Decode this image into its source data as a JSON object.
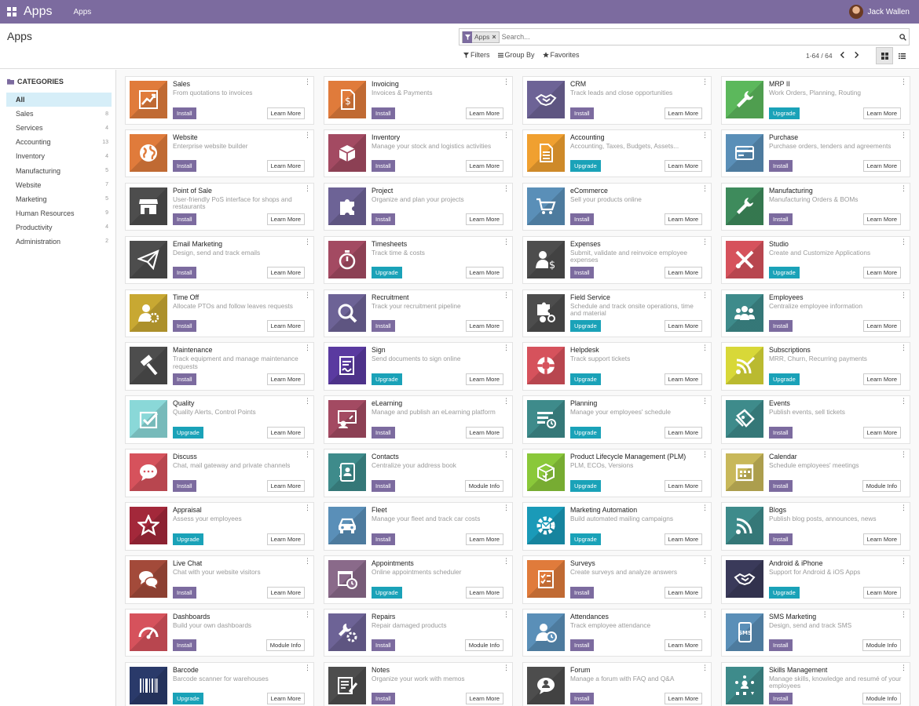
{
  "topbar": {
    "brand": "Apps",
    "menu": "Apps",
    "user": "Jack Wallen"
  },
  "control": {
    "title": "Apps",
    "facet": "Apps",
    "search_placeholder": "Search...",
    "filters": "Filters",
    "group_by": "Group By",
    "favorites": "Favorites",
    "pager": "1-64 / 64"
  },
  "sidebar": {
    "title": "CATEGORIES",
    "items": [
      {
        "label": "All",
        "count": ""
      },
      {
        "label": "Sales",
        "count": "8"
      },
      {
        "label": "Services",
        "count": "4"
      },
      {
        "label": "Accounting",
        "count": "13"
      },
      {
        "label": "Inventory",
        "count": "4"
      },
      {
        "label": "Manufacturing",
        "count": "5"
      },
      {
        "label": "Website",
        "count": "7"
      },
      {
        "label": "Marketing",
        "count": "5"
      },
      {
        "label": "Human Resources",
        "count": "9"
      },
      {
        "label": "Productivity",
        "count": "4"
      },
      {
        "label": "Administration",
        "count": "2"
      }
    ]
  },
  "apps": [
    {
      "name": "Sales",
      "desc": "From quotations to invoices",
      "action": "Install",
      "info": "Learn More",
      "color": "#e07b3b",
      "icon": "chart-icon"
    },
    {
      "name": "Invoicing",
      "desc": "Invoices & Payments",
      "action": "Install",
      "info": "Learn More",
      "color": "#e07b3b",
      "icon": "invoice-icon"
    },
    {
      "name": "CRM",
      "desc": "Track leads and close opportunities",
      "action": "Install",
      "info": "Learn More",
      "color": "#6d6396",
      "icon": "handshake-icon"
    },
    {
      "name": "MRP II",
      "desc": "Work Orders, Planning, Routing",
      "action": "Upgrade",
      "info": "Learn More",
      "color": "#5cb85c",
      "icon": "wrench-icon"
    },
    {
      "name": "Website",
      "desc": "Enterprise website builder",
      "action": "Install",
      "info": "Learn More",
      "color": "#e07b3b",
      "icon": "globe-icon"
    },
    {
      "name": "Inventory",
      "desc": "Manage your stock and logistics activities",
      "action": "Install",
      "info": "Learn More",
      "color": "#a34a62",
      "icon": "box-icon"
    },
    {
      "name": "Accounting",
      "desc": "Accounting, Taxes, Budgets, Assets...",
      "action": "Upgrade",
      "info": "Learn More",
      "color": "#f0a030",
      "icon": "document-icon"
    },
    {
      "name": "Purchase",
      "desc": "Purchase orders, tenders and agreements",
      "action": "Install",
      "info": "Learn More",
      "color": "#5a8fb8",
      "icon": "card-icon"
    },
    {
      "name": "Point of Sale",
      "desc": "User-friendly PoS interface for shops and restaurants",
      "action": "Install",
      "info": "Learn More",
      "color": "#4d4d4d",
      "icon": "store-icon"
    },
    {
      "name": "Project",
      "desc": "Organize and plan your projects",
      "action": "Install",
      "info": "Learn More",
      "color": "#6d6396",
      "icon": "puzzle-icon"
    },
    {
      "name": "eCommerce",
      "desc": "Sell your products online",
      "action": "Install",
      "info": "Learn More",
      "color": "#5a8fb8",
      "icon": "cart-icon"
    },
    {
      "name": "Manufacturing",
      "desc": "Manufacturing Orders & BOMs",
      "action": "Install",
      "info": "Learn More",
      "color": "#3e8b5c",
      "icon": "wrench-icon"
    },
    {
      "name": "Email Marketing",
      "desc": "Design, send and track emails",
      "action": "Install",
      "info": "Learn More",
      "color": "#4d4d4d",
      "icon": "paper-plane-icon"
    },
    {
      "name": "Timesheets",
      "desc": "Track time & costs",
      "action": "Upgrade",
      "info": "Learn More",
      "color": "#a34a62",
      "icon": "stopwatch-icon"
    },
    {
      "name": "Expenses",
      "desc": "Submit, validate and reinvoice employee expenses",
      "action": "Install",
      "info": "Learn More",
      "color": "#4d4d4d",
      "icon": "user-dollar-icon"
    },
    {
      "name": "Studio",
      "desc": "Create and Customize Applications",
      "action": "Upgrade",
      "info": "Learn More",
      "color": "#d6525c",
      "icon": "tools-icon"
    },
    {
      "name": "Time Off",
      "desc": "Allocate PTOs and follow leaves requests",
      "action": "Install",
      "info": "Learn More",
      "color": "#c8a832",
      "icon": "user-gear-icon"
    },
    {
      "name": "Recruitment",
      "desc": "Track your recruitment pipeline",
      "action": "Install",
      "info": "Learn More",
      "color": "#6d6396",
      "icon": "magnifier-icon"
    },
    {
      "name": "Field Service",
      "desc": "Schedule and track onsite operations, time and material",
      "action": "Upgrade",
      "info": "Learn More",
      "color": "#4d4d4d",
      "icon": "puzzle-user-icon"
    },
    {
      "name": "Employees",
      "desc": "Centralize employee information",
      "action": "Install",
      "info": "Learn More",
      "color": "#3e8b8b",
      "icon": "users-icon"
    },
    {
      "name": "Maintenance",
      "desc": "Track equipment and manage maintenance requests",
      "action": "Install",
      "info": "Learn More",
      "color": "#4d4d4d",
      "icon": "hammer-icon"
    },
    {
      "name": "Sign",
      "desc": "Send documents to sign online",
      "action": "Upgrade",
      "info": "Learn More",
      "color": "#5a3aa0",
      "icon": "sign-icon"
    },
    {
      "name": "Helpdesk",
      "desc": "Track support tickets",
      "action": "Upgrade",
      "info": "Learn More",
      "color": "#d6525c",
      "icon": "lifebuoy-icon"
    },
    {
      "name": "Subscriptions",
      "desc": "MRR, Churn, Recurring payments",
      "action": "Upgrade",
      "info": "Learn More",
      "color": "#d8d838",
      "icon": "rss-pen-icon"
    },
    {
      "name": "Quality",
      "desc": "Quality Alerts, Control Points",
      "action": "Upgrade",
      "info": "Learn More",
      "color": "#8ad8d8",
      "icon": "quality-icon"
    },
    {
      "name": "eLearning",
      "desc": "Manage and publish an eLearning platform",
      "action": "Install",
      "info": "Learn More",
      "color": "#a34a62",
      "icon": "teacher-icon"
    },
    {
      "name": "Planning",
      "desc": "Manage your employees' schedule",
      "action": "Upgrade",
      "info": "Learn More",
      "color": "#3e8b8b",
      "icon": "planning-icon"
    },
    {
      "name": "Events",
      "desc": "Publish events, sell tickets",
      "action": "Install",
      "info": "Learn More",
      "color": "#3e8b8b",
      "icon": "ticket-icon"
    },
    {
      "name": "Discuss",
      "desc": "Chat, mail gateway and private channels",
      "action": "Install",
      "info": "Learn More",
      "color": "#d6525c",
      "icon": "chat-icon"
    },
    {
      "name": "Contacts",
      "desc": "Centralize your address book",
      "action": "Install",
      "info": "Module Info",
      "color": "#3e8b8b",
      "icon": "address-book-icon"
    },
    {
      "name": "Product Lifecycle Management (PLM)",
      "desc": "PLM, ECOs, Versions",
      "action": "Upgrade",
      "info": "Learn More",
      "color": "#8ac83a",
      "icon": "plm-box-icon"
    },
    {
      "name": "Calendar",
      "desc": "Schedule employees' meetings",
      "action": "Install",
      "info": "Module Info",
      "color": "#c8b85a",
      "icon": "calendar-icon"
    },
    {
      "name": "Appraisal",
      "desc": "Assess your employees",
      "action": "Upgrade",
      "info": "Learn More",
      "color": "#a3283a",
      "icon": "star-icon"
    },
    {
      "name": "Fleet",
      "desc": "Manage your fleet and track car costs",
      "action": "Install",
      "info": "Learn More",
      "color": "#5a8fb8",
      "icon": "car-icon"
    },
    {
      "name": "Marketing Automation",
      "desc": "Build automated mailing campaigns",
      "action": "Upgrade",
      "info": "Learn More",
      "color": "#1a9ab8",
      "icon": "gear-mail-icon"
    },
    {
      "name": "Blogs",
      "desc": "Publish blog posts, announces, news",
      "action": "Install",
      "info": "Learn More",
      "color": "#3e8b8b",
      "icon": "rss-icon"
    },
    {
      "name": "Live Chat",
      "desc": "Chat with your website visitors",
      "action": "Install",
      "info": "Learn More",
      "color": "#a34a3a",
      "icon": "chats-icon"
    },
    {
      "name": "Appointments",
      "desc": "Online appointments scheduler",
      "action": "Upgrade",
      "info": "Learn More",
      "color": "#8a6a8a",
      "icon": "calendar-clock-icon"
    },
    {
      "name": "Surveys",
      "desc": "Create surveys and analyze answers",
      "action": "Install",
      "info": "Learn More",
      "color": "#e07b3b",
      "icon": "survey-icon"
    },
    {
      "name": "Android & iPhone",
      "desc": "Support for Android & iOS Apps",
      "action": "Upgrade",
      "info": "Learn More",
      "color": "#3a3a5a",
      "icon": "handshake-icon"
    },
    {
      "name": "Dashboards",
      "desc": "Build your own dashboards",
      "action": "Install",
      "info": "Module Info",
      "color": "#d6525c",
      "icon": "gauge-icon"
    },
    {
      "name": "Repairs",
      "desc": "Repair damaged products",
      "action": "Install",
      "info": "Module Info",
      "color": "#6d6396",
      "icon": "wrench-gear-icon"
    },
    {
      "name": "Attendances",
      "desc": "Track employee attendance",
      "action": "Install",
      "info": "Learn More",
      "color": "#5a8fb8",
      "icon": "user-clock-icon"
    },
    {
      "name": "SMS Marketing",
      "desc": "Design, send and track SMS",
      "action": "Install",
      "info": "Module Info",
      "color": "#5a8fb8",
      "icon": "sms-icon"
    },
    {
      "name": "Barcode",
      "desc": "Barcode scanner for warehouses",
      "action": "Upgrade",
      "info": "Learn More",
      "color": "#2a3a6a",
      "icon": "barcode-icon"
    },
    {
      "name": "Notes",
      "desc": "Organize your work with memos",
      "action": "Install",
      "info": "Learn More",
      "color": "#4d4d4d",
      "icon": "note-pen-icon"
    },
    {
      "name": "Forum",
      "desc": "Manage a forum with FAQ and Q&A",
      "action": "Install",
      "info": "Learn More",
      "color": "#4d4d4d",
      "icon": "forum-icon"
    },
    {
      "name": "Skills Management",
      "desc": "Manage skills, knowledge and resumé of your employees",
      "action": "Install",
      "info": "Module Info",
      "color": "#3e8b8b",
      "icon": "skills-icon"
    }
  ]
}
